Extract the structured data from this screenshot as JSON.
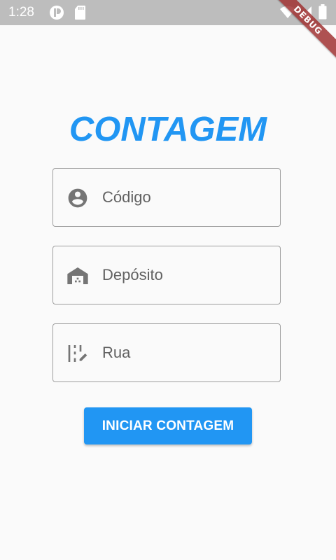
{
  "status_bar": {
    "time": "1:28",
    "icons": [
      "pinwheel-icon",
      "sd-card-icon",
      "wifi-icon",
      "signal-icon",
      "battery-icon"
    ]
  },
  "debug_banner": {
    "label": "DEBUG"
  },
  "main": {
    "title": "CONTAGEM",
    "fields": [
      {
        "icon": "account-circle-icon",
        "placeholder": "Código",
        "value": ""
      },
      {
        "icon": "warehouse-icon",
        "placeholder": "Depósito",
        "value": ""
      },
      {
        "icon": "shelf-edit-icon",
        "placeholder": "Rua",
        "value": ""
      }
    ],
    "button_label": "INICIAR CONTAGEM"
  },
  "colors": {
    "accent": "#2196f3",
    "status_bar": "#bdbdbd",
    "background": "#fafafa",
    "field_border": "#9e9e9e",
    "icon": "#757575",
    "debug_ribbon": "#a03232"
  }
}
